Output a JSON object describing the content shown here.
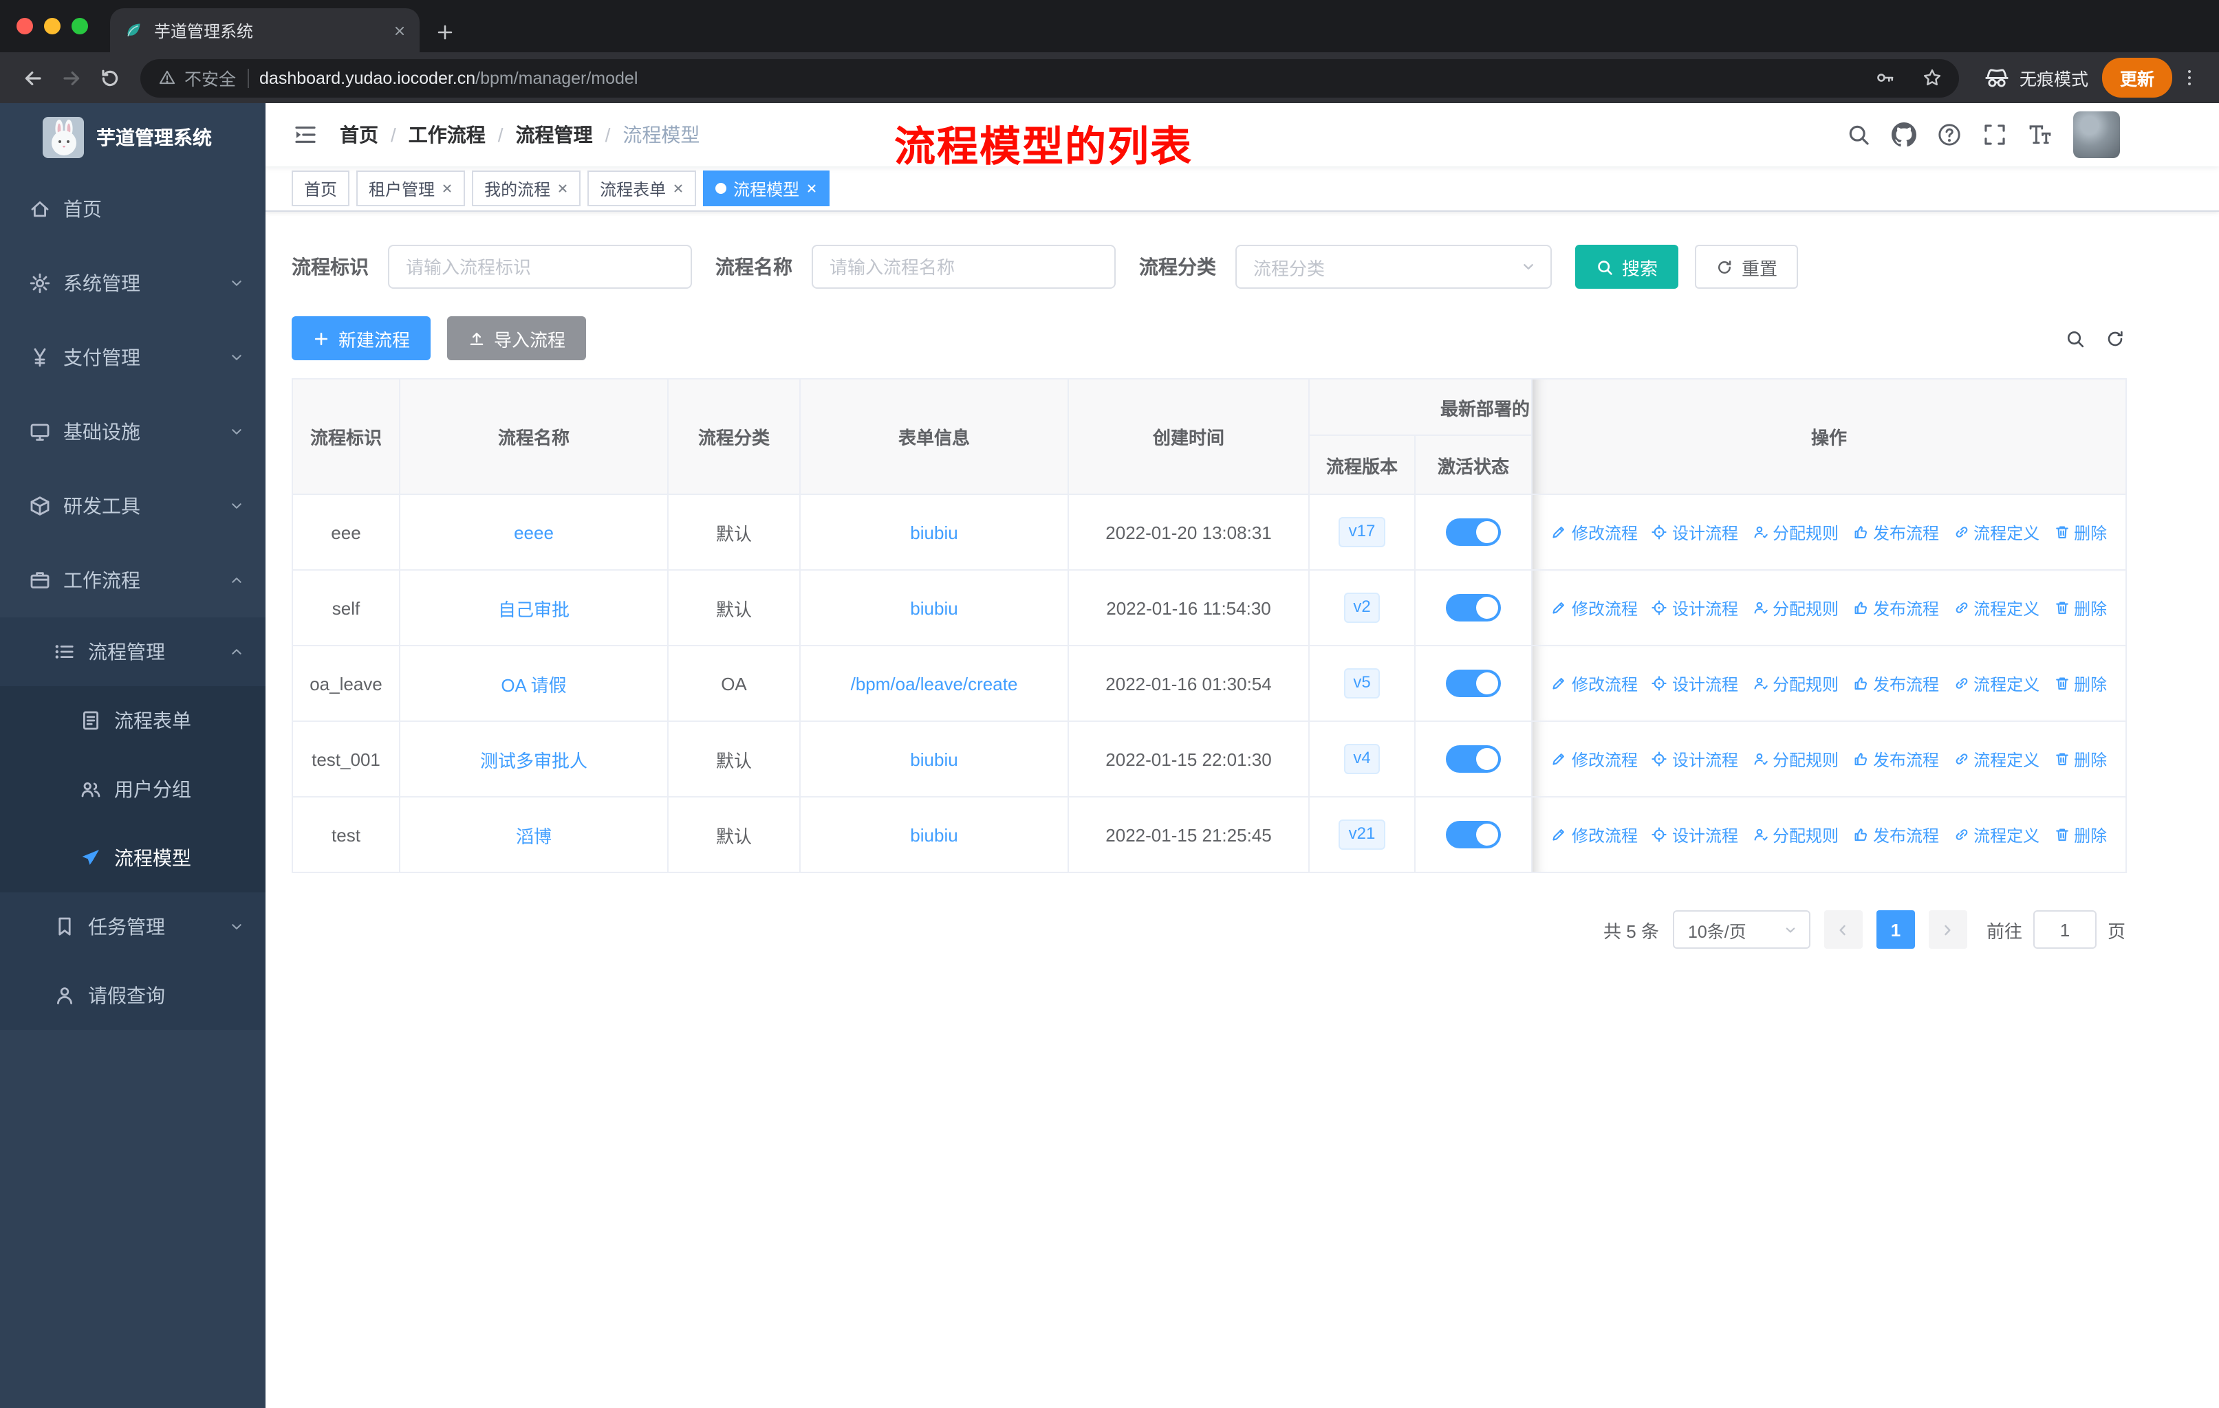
{
  "colors": {
    "accent": "#409eff",
    "search_button": "#13b8a6",
    "sidebar_bg": "#304156",
    "link": "#409eff",
    "annotation": "#fe0b00"
  },
  "browser": {
    "tab_title": "芋道管理系统",
    "security_label": "不安全",
    "url_host": "dashboard.yudao.iocoder.cn",
    "url_path": "/bpm/manager/model",
    "incognito_label": "无痕模式",
    "update_label": "更新"
  },
  "annotation": "流程模型的列表",
  "sidebar": {
    "logo_title": "芋道管理系统",
    "menu": [
      {
        "name": "home",
        "label": "首页",
        "icon": "home-icon",
        "level": 1
      },
      {
        "name": "system-management",
        "label": "系统管理",
        "icon": "gear-icon",
        "level": 1,
        "chevron": "down"
      },
      {
        "name": "payment-management",
        "label": "支付管理",
        "icon": "yen-icon",
        "level": 1,
        "chevron": "down"
      },
      {
        "name": "infrastructure",
        "label": "基础设施",
        "icon": "monitor-icon",
        "level": 1,
        "chevron": "down"
      },
      {
        "name": "dev-tools",
        "label": "研发工具",
        "icon": "toolbox-icon",
        "level": 1,
        "chevron": "down"
      },
      {
        "name": "workflow",
        "label": "工作流程",
        "icon": "briefcase-icon",
        "level": 1,
        "chevron": "up"
      },
      {
        "name": "process-management",
        "label": "流程管理",
        "icon": "list-icon",
        "level": 2,
        "chevron": "up"
      },
      {
        "name": "process-form",
        "label": "流程表单",
        "icon": "document-icon",
        "level": 3
      },
      {
        "name": "user-group",
        "label": "用户分组",
        "icon": "users-icon",
        "level": 3
      },
      {
        "name": "process-model",
        "label": "流程模型",
        "icon": "send-icon",
        "level": 3,
        "active": true
      },
      {
        "name": "task-management",
        "label": "任务管理",
        "icon": "bookmark-icon",
        "level": 2,
        "chevron": "down"
      },
      {
        "name": "leave-query",
        "label": "请假查询",
        "icon": "user-icon",
        "level": 2
      }
    ]
  },
  "navbar": {
    "breadcrumb": [
      "首页",
      "工作流程",
      "流程管理",
      "流程模型"
    ]
  },
  "tags": [
    {
      "name": "tag-home",
      "label": "首页",
      "closable": false,
      "active": false
    },
    {
      "name": "tag-tenant-management",
      "label": "租户管理",
      "closable": true,
      "active": false
    },
    {
      "name": "tag-my-flows",
      "label": "我的流程",
      "closable": true,
      "active": false
    },
    {
      "name": "tag-process-form",
      "label": "流程表单",
      "closable": true,
      "active": false
    },
    {
      "name": "tag-process-model",
      "label": "流程模型",
      "closable": true,
      "active": true
    }
  ],
  "filters": {
    "fields": [
      {
        "name": "process-id",
        "label": "流程标识",
        "placeholder": "请输入流程标识",
        "type": "input"
      },
      {
        "name": "process-name",
        "label": "流程名称",
        "placeholder": "请输入流程名称",
        "type": "input"
      },
      {
        "name": "process-category",
        "label": "流程分类",
        "placeholder": "流程分类",
        "type": "select"
      }
    ],
    "search_label": "搜索",
    "reset_label": "重置"
  },
  "toolbar": {
    "create_label": "新建流程",
    "import_label": "导入流程"
  },
  "table": {
    "headers": {
      "id": "流程标识",
      "name": "流程名称",
      "category": "流程分类",
      "form": "表单信息",
      "created": "创建时间",
      "version": "流程版本",
      "status": "激活状态",
      "ops": "操作"
    },
    "group_header": "最新部署的",
    "op_labels": [
      {
        "name": "modify-flow-link",
        "label": "修改流程",
        "icon": "edit-icon"
      },
      {
        "name": "design-flow-link",
        "label": "设计流程",
        "icon": "design-icon"
      },
      {
        "name": "assign-rule-link",
        "label": "分配规则",
        "icon": "assign-icon"
      },
      {
        "name": "publish-flow-link",
        "label": "发布流程",
        "icon": "publish-icon"
      },
      {
        "name": "flow-definition-link",
        "label": "流程定义",
        "icon": "definition-icon"
      },
      {
        "name": "delete-link",
        "label": "删除",
        "icon": "delete-icon"
      }
    ],
    "rows": [
      {
        "id": "eee",
        "name": "eeee",
        "category": "默认",
        "form": "biubiu",
        "created": "2022-01-20 13:08:31",
        "version": "v17",
        "active": true
      },
      {
        "id": "self",
        "name": "自己审批",
        "category": "默认",
        "form": "biubiu",
        "created": "2022-01-16 11:54:30",
        "version": "v2",
        "active": true
      },
      {
        "id": "oa_leave",
        "name": "OA 请假",
        "category": "OA",
        "form": "/bpm/oa/leave/create",
        "created": "2022-01-16 01:30:54",
        "version": "v5",
        "active": true
      },
      {
        "id": "test_001",
        "name": "测试多审批人",
        "category": "默认",
        "form": "biubiu",
        "created": "2022-01-15 22:01:30",
        "version": "v4",
        "active": true
      },
      {
        "id": "test",
        "name": "滔博",
        "category": "默认",
        "form": "biubiu",
        "created": "2022-01-15 21:25:45",
        "version": "v21",
        "active": true
      }
    ]
  },
  "pagination": {
    "total": "共 5 条",
    "page_size": "10条/页",
    "current_page": "1",
    "goto_label": "前往",
    "goto_value": "1",
    "page_unit": "页"
  }
}
